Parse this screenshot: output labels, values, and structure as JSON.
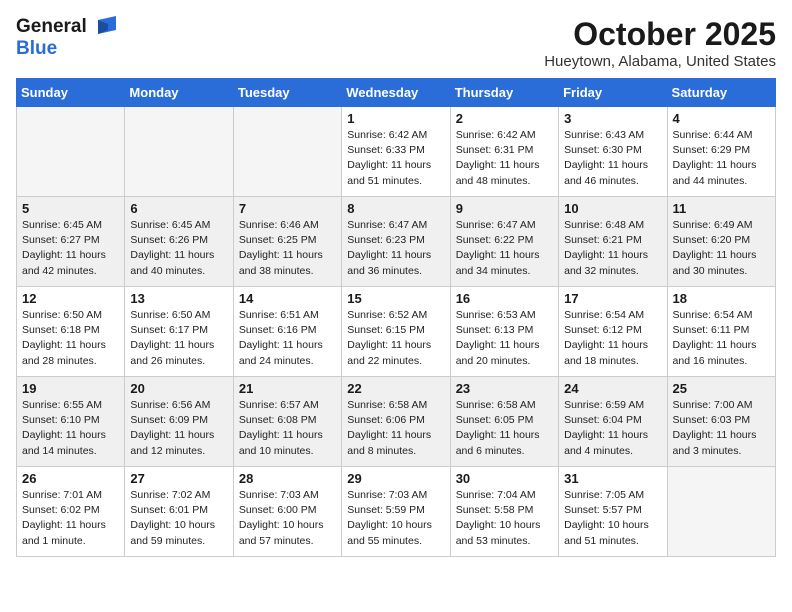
{
  "logo": {
    "general": "General",
    "blue": "Blue"
  },
  "title": {
    "month": "October 2025",
    "location": "Hueytown, Alabama, United States"
  },
  "weekdays": [
    "Sunday",
    "Monday",
    "Tuesday",
    "Wednesday",
    "Thursday",
    "Friday",
    "Saturday"
  ],
  "weeks": [
    [
      {
        "day": "",
        "empty": true
      },
      {
        "day": "",
        "empty": true
      },
      {
        "day": "",
        "empty": true
      },
      {
        "day": "1",
        "sunrise": "6:42 AM",
        "sunset": "6:33 PM",
        "daylight": "11 hours and 51 minutes."
      },
      {
        "day": "2",
        "sunrise": "6:42 AM",
        "sunset": "6:31 PM",
        "daylight": "11 hours and 48 minutes."
      },
      {
        "day": "3",
        "sunrise": "6:43 AM",
        "sunset": "6:30 PM",
        "daylight": "11 hours and 46 minutes."
      },
      {
        "day": "4",
        "sunrise": "6:44 AM",
        "sunset": "6:29 PM",
        "daylight": "11 hours and 44 minutes."
      }
    ],
    [
      {
        "day": "5",
        "sunrise": "6:45 AM",
        "sunset": "6:27 PM",
        "daylight": "11 hours and 42 minutes."
      },
      {
        "day": "6",
        "sunrise": "6:45 AM",
        "sunset": "6:26 PM",
        "daylight": "11 hours and 40 minutes."
      },
      {
        "day": "7",
        "sunrise": "6:46 AM",
        "sunset": "6:25 PM",
        "daylight": "11 hours and 38 minutes."
      },
      {
        "day": "8",
        "sunrise": "6:47 AM",
        "sunset": "6:23 PM",
        "daylight": "11 hours and 36 minutes."
      },
      {
        "day": "9",
        "sunrise": "6:47 AM",
        "sunset": "6:22 PM",
        "daylight": "11 hours and 34 minutes."
      },
      {
        "day": "10",
        "sunrise": "6:48 AM",
        "sunset": "6:21 PM",
        "daylight": "11 hours and 32 minutes."
      },
      {
        "day": "11",
        "sunrise": "6:49 AM",
        "sunset": "6:20 PM",
        "daylight": "11 hours and 30 minutes."
      }
    ],
    [
      {
        "day": "12",
        "sunrise": "6:50 AM",
        "sunset": "6:18 PM",
        "daylight": "11 hours and 28 minutes."
      },
      {
        "day": "13",
        "sunrise": "6:50 AM",
        "sunset": "6:17 PM",
        "daylight": "11 hours and 26 minutes."
      },
      {
        "day": "14",
        "sunrise": "6:51 AM",
        "sunset": "6:16 PM",
        "daylight": "11 hours and 24 minutes."
      },
      {
        "day": "15",
        "sunrise": "6:52 AM",
        "sunset": "6:15 PM",
        "daylight": "11 hours and 22 minutes."
      },
      {
        "day": "16",
        "sunrise": "6:53 AM",
        "sunset": "6:13 PM",
        "daylight": "11 hours and 20 minutes."
      },
      {
        "day": "17",
        "sunrise": "6:54 AM",
        "sunset": "6:12 PM",
        "daylight": "11 hours and 18 minutes."
      },
      {
        "day": "18",
        "sunrise": "6:54 AM",
        "sunset": "6:11 PM",
        "daylight": "11 hours and 16 minutes."
      }
    ],
    [
      {
        "day": "19",
        "sunrise": "6:55 AM",
        "sunset": "6:10 PM",
        "daylight": "11 hours and 14 minutes."
      },
      {
        "day": "20",
        "sunrise": "6:56 AM",
        "sunset": "6:09 PM",
        "daylight": "11 hours and 12 minutes."
      },
      {
        "day": "21",
        "sunrise": "6:57 AM",
        "sunset": "6:08 PM",
        "daylight": "11 hours and 10 minutes."
      },
      {
        "day": "22",
        "sunrise": "6:58 AM",
        "sunset": "6:06 PM",
        "daylight": "11 hours and 8 minutes."
      },
      {
        "day": "23",
        "sunrise": "6:58 AM",
        "sunset": "6:05 PM",
        "daylight": "11 hours and 6 minutes."
      },
      {
        "day": "24",
        "sunrise": "6:59 AM",
        "sunset": "6:04 PM",
        "daylight": "11 hours and 4 minutes."
      },
      {
        "day": "25",
        "sunrise": "7:00 AM",
        "sunset": "6:03 PM",
        "daylight": "11 hours and 3 minutes."
      }
    ],
    [
      {
        "day": "26",
        "sunrise": "7:01 AM",
        "sunset": "6:02 PM",
        "daylight": "11 hours and 1 minute."
      },
      {
        "day": "27",
        "sunrise": "7:02 AM",
        "sunset": "6:01 PM",
        "daylight": "10 hours and 59 minutes."
      },
      {
        "day": "28",
        "sunrise": "7:03 AM",
        "sunset": "6:00 PM",
        "daylight": "10 hours and 57 minutes."
      },
      {
        "day": "29",
        "sunrise": "7:03 AM",
        "sunset": "5:59 PM",
        "daylight": "10 hours and 55 minutes."
      },
      {
        "day": "30",
        "sunrise": "7:04 AM",
        "sunset": "5:58 PM",
        "daylight": "10 hours and 53 minutes."
      },
      {
        "day": "31",
        "sunrise": "7:05 AM",
        "sunset": "5:57 PM",
        "daylight": "10 hours and 51 minutes."
      },
      {
        "day": "",
        "empty": true
      }
    ]
  ],
  "labels": {
    "sunrise": "Sunrise:",
    "sunset": "Sunset:",
    "daylight": "Daylight:"
  }
}
